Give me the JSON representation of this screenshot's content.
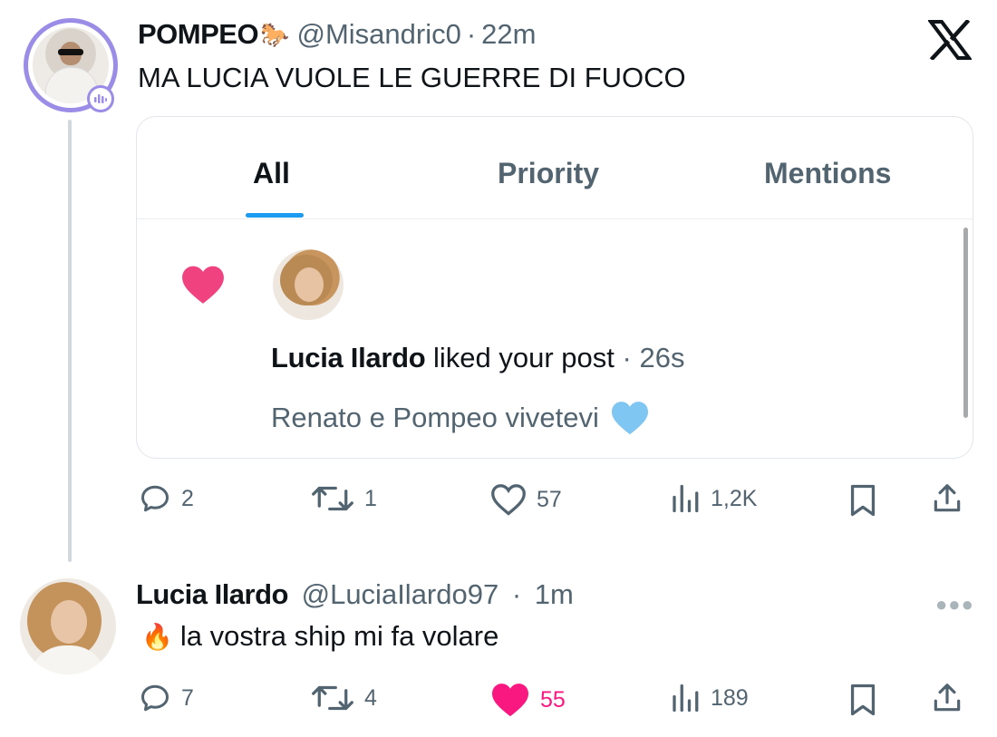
{
  "post": {
    "display_name": "POMPEO",
    "emoji": "🐎",
    "handle": "@Misandric0",
    "separator": "·",
    "time": "22m",
    "text": "MA LUCIA VUOLE LE GUERRE DI FUOCO",
    "actions": {
      "replies": "2",
      "reposts": "1",
      "likes": "57",
      "views": "1,2K"
    }
  },
  "embedded_notifications": {
    "tabs": [
      {
        "label": "All",
        "active": true
      },
      {
        "label": "Priority",
        "active": false
      },
      {
        "label": "Mentions",
        "active": false
      }
    ],
    "notification": {
      "user": "Lucia Ilardo",
      "action": "liked your post",
      "separator": "·",
      "time": "26s",
      "post_preview": "Renato e Pompeo vivetevi",
      "preview_emoji": "blue-heart"
    }
  },
  "reply": {
    "display_name": "Lucia Ilardo",
    "handle": "@LuciaIlardo97",
    "separator": "·",
    "time": "1m",
    "emoji": "🔥",
    "text": "la vostra ship mi fa volare",
    "more_icon": "more-horizontal-icon",
    "actions": {
      "replies": "7",
      "reposts": "4",
      "likes": "55",
      "views": "189",
      "liked": true
    }
  },
  "colors": {
    "like_pink": "#f91880",
    "tab_accent": "#1d9bf0",
    "spaces_ring": "#9b8ce8",
    "secondary_text": "#536471"
  }
}
